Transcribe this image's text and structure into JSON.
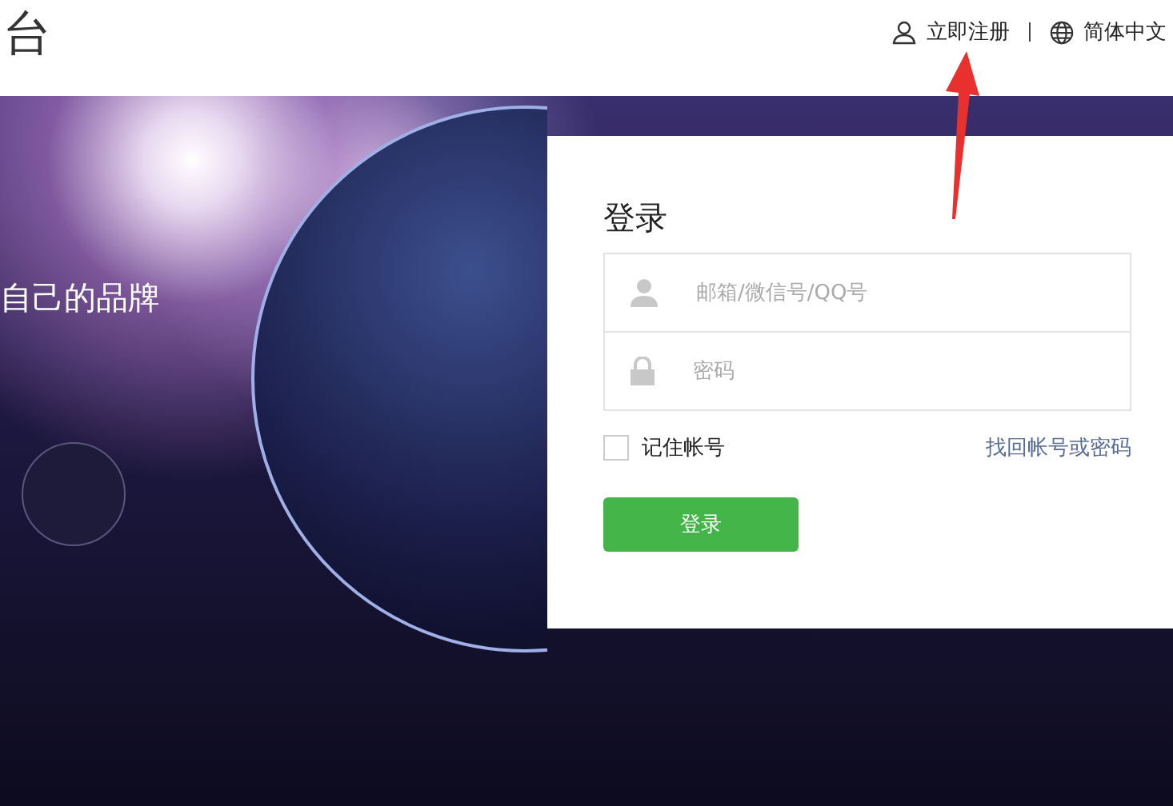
{
  "header": {
    "logo_text": "台",
    "links": [
      {
        "kind": "register",
        "label": "立即注册"
      },
      {
        "kind": "language",
        "label": "简体中文"
      }
    ]
  },
  "banner": {
    "slogan": "自己的品牌"
  },
  "login": {
    "title": "登录",
    "account_field": {
      "placeholder": "邮箱/微信号/QQ号"
    },
    "password_field": {
      "placeholder": "密码"
    },
    "remember": {
      "label": "记住帐号",
      "checked": false
    },
    "forgot_link": "找回帐号或密码",
    "submit": "登录"
  },
  "annotation": {
    "kind": "arrow"
  }
}
